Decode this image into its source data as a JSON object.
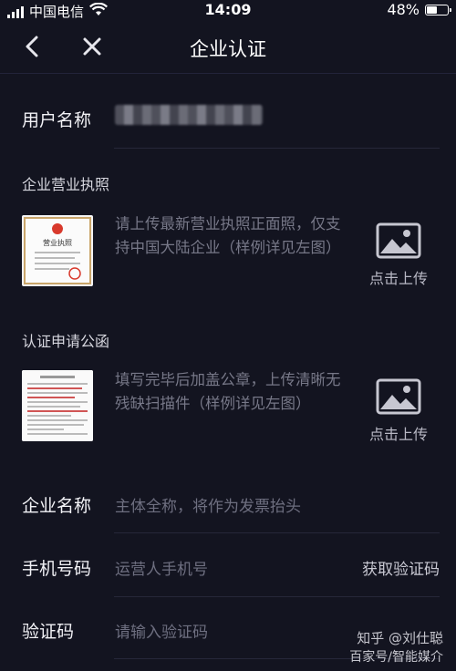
{
  "status_bar": {
    "carrier": "中国电信",
    "time": "14:09",
    "battery": "48%",
    "battery_level": 0.48,
    "icons": [
      "signal-icon",
      "wifi-icon",
      "battery-icon"
    ]
  },
  "nav": {
    "title": "企业认证",
    "icons": [
      "back-arrow-icon",
      "close-icon"
    ]
  },
  "user_name": {
    "label": "用户名称"
  },
  "business_license": {
    "section_title": "企业营业执照",
    "thumb_title": "营业执照",
    "description": "请上传最新营业执照正面照，仅支持中国大陆企业（样例详见左图）",
    "upload_label": "点击上传"
  },
  "application_letter": {
    "section_title": "认证申请公函",
    "description": "填写完毕后加盖公章，上传清晰无残缺扫描件（样例详见左图）",
    "upload_label": "点击上传"
  },
  "company_name": {
    "label": "企业名称",
    "placeholder": "主体全称，将作为发票抬头"
  },
  "phone": {
    "label": "手机号码",
    "placeholder": "运营人手机号",
    "get_code": "获取验证码"
  },
  "verify_code": {
    "label": "验证码",
    "placeholder": "请输入验证码"
  },
  "watermark": {
    "line1": "知乎 @刘仕聪",
    "line2": "百家号/智能媒介"
  },
  "colors": {
    "background": "#131420",
    "placeholder": "#6e6f80",
    "divider": "#262739"
  }
}
